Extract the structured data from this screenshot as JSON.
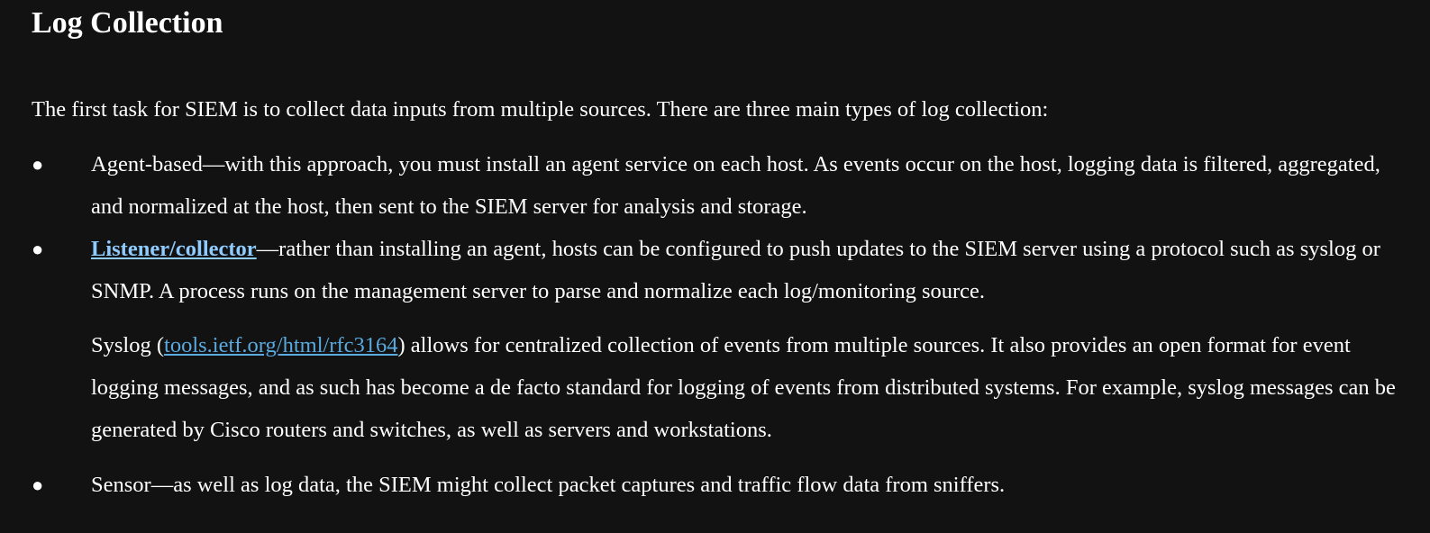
{
  "heading": "Log Collection",
  "intro": "The first task for SIEM is to collect data inputs from multiple sources. There are three main types of log collection:",
  "bullet_glyph": "●",
  "items": [
    {
      "text": "Agent-based—with this approach, you must install an agent service on each host. As events occur on the host, logging data is filtered, aggregated, and normalized at the host, then sent to the SIEM server for analysis and storage."
    },
    {
      "link_label": "Listener/collector",
      "text": "—rather than installing an agent, hosts can be configured to push updates to the SIEM server using a protocol such as syslog or SNMP. A process runs on the management server to parse and normalize each log/monitoring source."
    },
    {
      "text": "Sensor—as well as log data, the SIEM might collect packet captures and traffic flow data from sniffers."
    }
  ],
  "syslog": {
    "before": "Syslog (",
    "link": "tools.ietf.org/html/rfc3164",
    "after": ") allows for centralized collection of events from multiple sources. It also provides an open format for event logging messages, and as such has become a de facto standard for logging of events from distributed systems. For example, syslog messages can be generated by Cisco routers and switches, as well as servers and workstations."
  },
  "colors": {
    "background": "#121212",
    "text": "#ffffff",
    "term_link": "#8ecbff",
    "url_link": "#5aa9df"
  }
}
